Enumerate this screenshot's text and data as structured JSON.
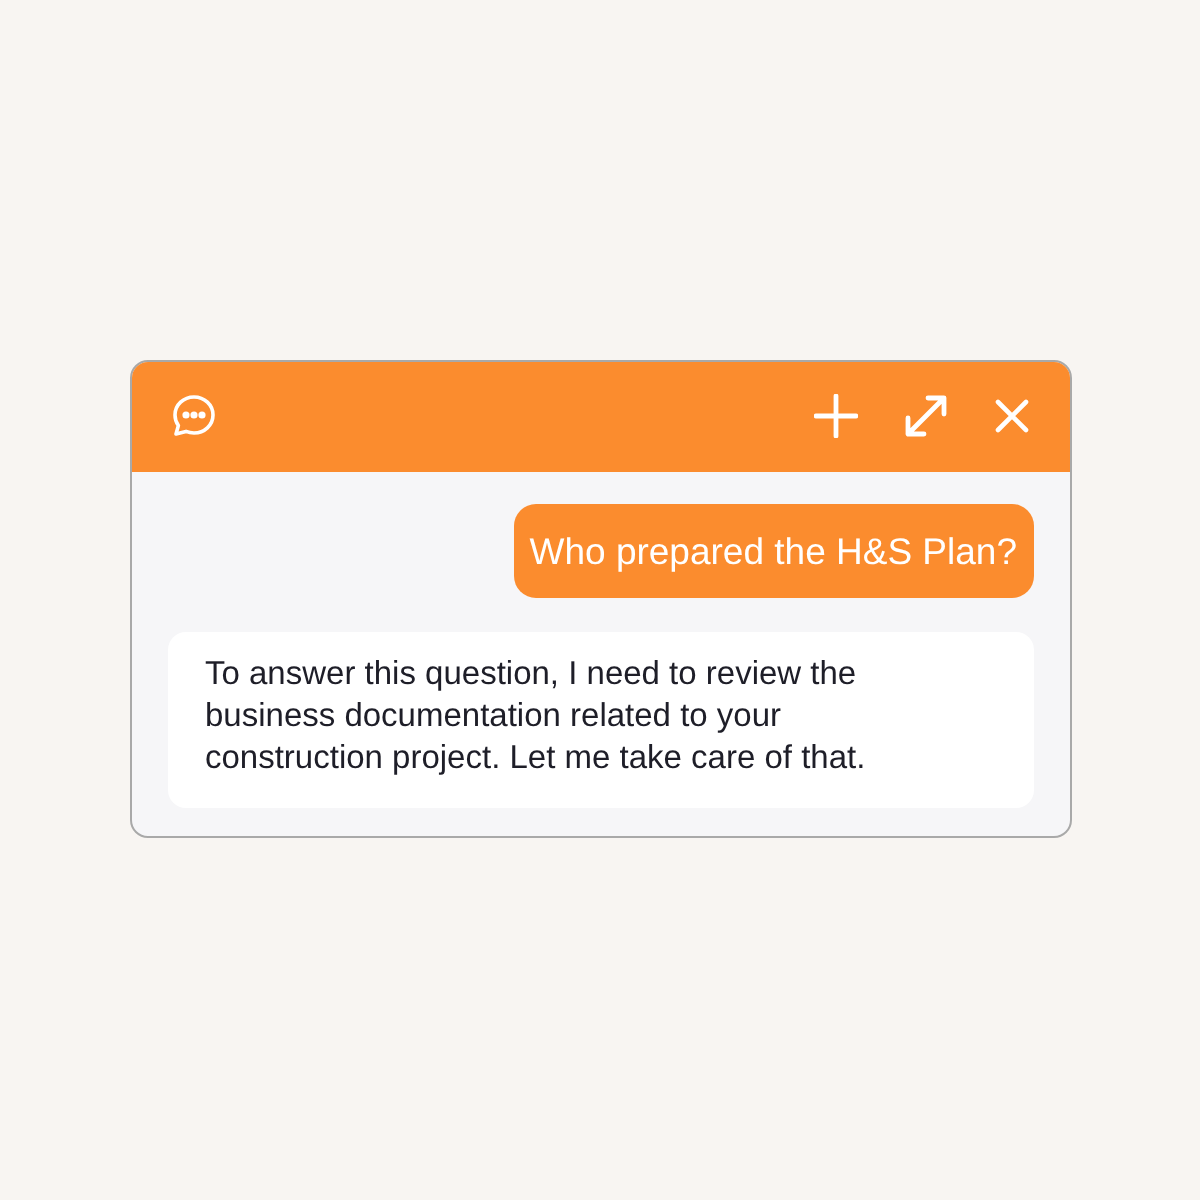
{
  "messages": [
    {
      "kind": "user",
      "text": "Who prepared the H&S Plan?"
    },
    {
      "kind": "assistant",
      "text": "To answer this question, I need to review the business documentation related to your construction project. Let me take care of that."
    }
  ]
}
